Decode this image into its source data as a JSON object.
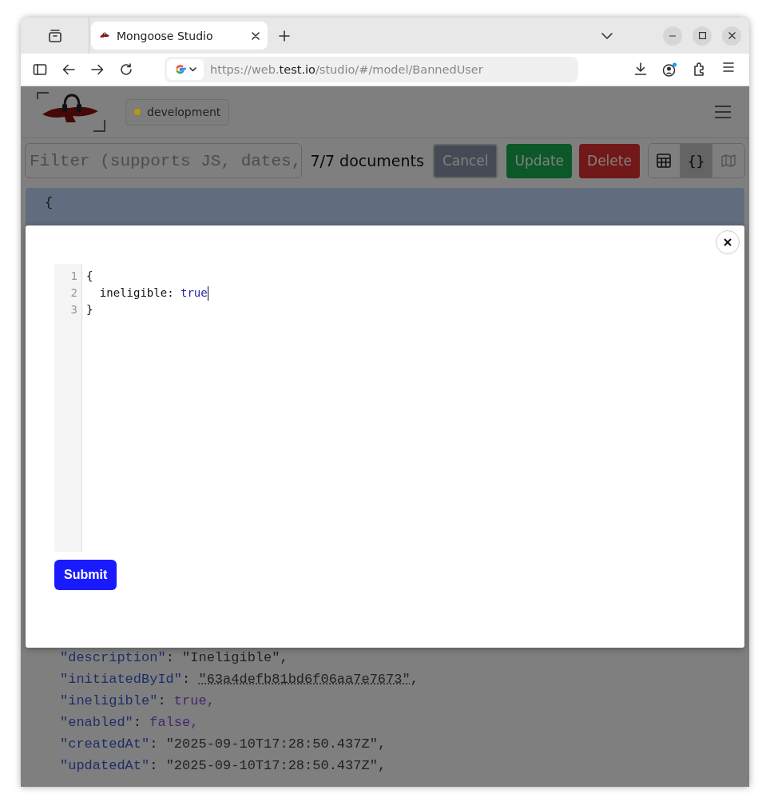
{
  "browser": {
    "tab": {
      "title": "Mongoose Studio",
      "selected": true
    },
    "address": {
      "scheme": "https://web.",
      "domain": "test.io",
      "path": "/studio/#/model/BannedUser"
    }
  },
  "header": {
    "environment": {
      "label": "development",
      "color": "#b8960a"
    }
  },
  "toolbar": {
    "filter": {
      "placeholder": "Filter (supports JS, dates,"
    },
    "count": "7/7 documents",
    "buttons": [
      {
        "label": "Cancel",
        "kind": "cancel"
      },
      {
        "label": "Update",
        "kind": "update"
      },
      {
        "label": "Delete",
        "kind": "delete"
      }
    ],
    "views": [
      {
        "kind": "table",
        "selected": false,
        "disabled": false
      },
      {
        "kind": "json",
        "label": "{}",
        "selected": true,
        "disabled": false
      },
      {
        "kind": "map",
        "selected": false,
        "disabled": true
      }
    ]
  },
  "document": {
    "brace": "{",
    "fields_below": [
      {
        "tokens": [
          {
            "kind": "key",
            "text": "\"description\""
          },
          {
            "kind": "punct",
            "text": ": "
          },
          {
            "kind": "string",
            "text": "\"Ineligible\""
          },
          {
            "kind": "punct",
            "text": ","
          }
        ]
      },
      {
        "tokens": [
          {
            "kind": "key",
            "text": "\"initiatedById\""
          },
          {
            "kind": "punct",
            "text": ": "
          },
          {
            "kind": "ref",
            "text": "\"63a4defb81bd6f06aa7e7673\""
          },
          {
            "kind": "punct",
            "text": ","
          }
        ]
      },
      {
        "tokens": [
          {
            "kind": "key",
            "text": "\"ineligible\""
          },
          {
            "kind": "punct",
            "text": ": "
          },
          {
            "kind": "bool",
            "text": "true,"
          }
        ]
      },
      {
        "tokens": [
          {
            "kind": "key",
            "text": "\"enabled\""
          },
          {
            "kind": "punct",
            "text": ": "
          },
          {
            "kind": "bool",
            "text": "false,"
          }
        ]
      },
      {
        "tokens": [
          {
            "kind": "key",
            "text": "\"createdAt\""
          },
          {
            "kind": "punct",
            "text": ": "
          },
          {
            "kind": "string",
            "text": "\"2025-09-10T17:28:50.437Z\""
          },
          {
            "kind": "punct",
            "text": ","
          }
        ]
      },
      {
        "tokens": [
          {
            "kind": "key",
            "text": "\"updatedAt\""
          },
          {
            "kind": "punct",
            "text": ": "
          },
          {
            "kind": "string",
            "text": "\"2025-09-10T17:28:50.437Z\""
          },
          {
            "kind": "punct",
            "text": ","
          }
        ]
      }
    ]
  },
  "modal": {
    "editor": {
      "lines": [
        {
          "number": "1",
          "cursor": false,
          "tokens": [
            {
              "kind": "punct",
              "text": "{"
            }
          ],
          "children": [
            {
              "number": "2",
              "cursor": true,
              "tokens": [
                {
                  "kind": "prop",
                  "text": "ineligible: "
                },
                {
                  "kind": "bool",
                  "text": "true"
                }
              ]
            }
          ]
        },
        {
          "number": "3",
          "cursor": false,
          "tokens": [
            {
              "kind": "punct",
              "text": "}"
            }
          ]
        }
      ]
    },
    "submit": "Submit"
  }
}
